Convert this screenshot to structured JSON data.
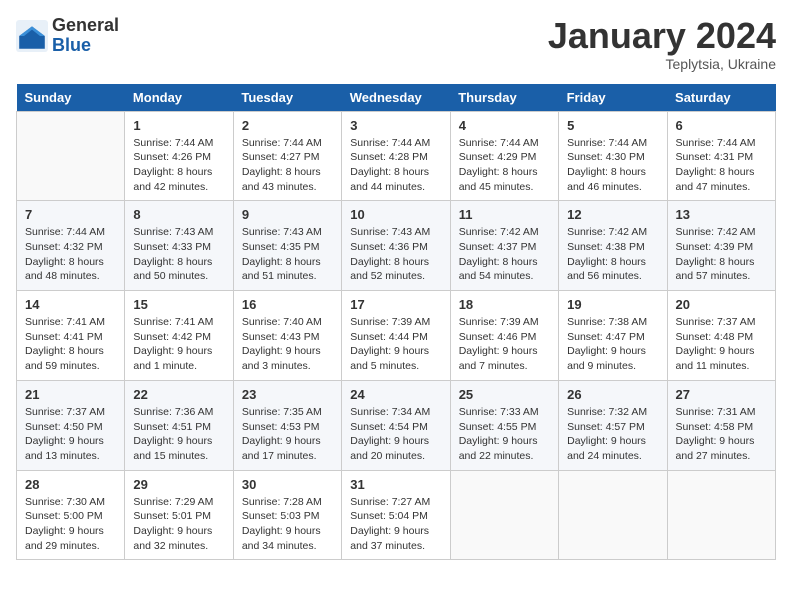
{
  "header": {
    "logo_general": "General",
    "logo_blue": "Blue",
    "month_title": "January 2024",
    "location": "Teplytsia, Ukraine"
  },
  "days_of_week": [
    "Sunday",
    "Monday",
    "Tuesday",
    "Wednesday",
    "Thursday",
    "Friday",
    "Saturday"
  ],
  "weeks": [
    [
      {
        "day": "",
        "sunrise": "",
        "sunset": "",
        "daylight": ""
      },
      {
        "day": "1",
        "sunrise": "Sunrise: 7:44 AM",
        "sunset": "Sunset: 4:26 PM",
        "daylight": "Daylight: 8 hours and 42 minutes."
      },
      {
        "day": "2",
        "sunrise": "Sunrise: 7:44 AM",
        "sunset": "Sunset: 4:27 PM",
        "daylight": "Daylight: 8 hours and 43 minutes."
      },
      {
        "day": "3",
        "sunrise": "Sunrise: 7:44 AM",
        "sunset": "Sunset: 4:28 PM",
        "daylight": "Daylight: 8 hours and 44 minutes."
      },
      {
        "day": "4",
        "sunrise": "Sunrise: 7:44 AM",
        "sunset": "Sunset: 4:29 PM",
        "daylight": "Daylight: 8 hours and 45 minutes."
      },
      {
        "day": "5",
        "sunrise": "Sunrise: 7:44 AM",
        "sunset": "Sunset: 4:30 PM",
        "daylight": "Daylight: 8 hours and 46 minutes."
      },
      {
        "day": "6",
        "sunrise": "Sunrise: 7:44 AM",
        "sunset": "Sunset: 4:31 PM",
        "daylight": "Daylight: 8 hours and 47 minutes."
      }
    ],
    [
      {
        "day": "7",
        "sunrise": "Sunrise: 7:44 AM",
        "sunset": "Sunset: 4:32 PM",
        "daylight": "Daylight: 8 hours and 48 minutes."
      },
      {
        "day": "8",
        "sunrise": "Sunrise: 7:43 AM",
        "sunset": "Sunset: 4:33 PM",
        "daylight": "Daylight: 8 hours and 50 minutes."
      },
      {
        "day": "9",
        "sunrise": "Sunrise: 7:43 AM",
        "sunset": "Sunset: 4:35 PM",
        "daylight": "Daylight: 8 hours and 51 minutes."
      },
      {
        "day": "10",
        "sunrise": "Sunrise: 7:43 AM",
        "sunset": "Sunset: 4:36 PM",
        "daylight": "Daylight: 8 hours and 52 minutes."
      },
      {
        "day": "11",
        "sunrise": "Sunrise: 7:42 AM",
        "sunset": "Sunset: 4:37 PM",
        "daylight": "Daylight: 8 hours and 54 minutes."
      },
      {
        "day": "12",
        "sunrise": "Sunrise: 7:42 AM",
        "sunset": "Sunset: 4:38 PM",
        "daylight": "Daylight: 8 hours and 56 minutes."
      },
      {
        "day": "13",
        "sunrise": "Sunrise: 7:42 AM",
        "sunset": "Sunset: 4:39 PM",
        "daylight": "Daylight: 8 hours and 57 minutes."
      }
    ],
    [
      {
        "day": "14",
        "sunrise": "Sunrise: 7:41 AM",
        "sunset": "Sunset: 4:41 PM",
        "daylight": "Daylight: 8 hours and 59 minutes."
      },
      {
        "day": "15",
        "sunrise": "Sunrise: 7:41 AM",
        "sunset": "Sunset: 4:42 PM",
        "daylight": "Daylight: 9 hours and 1 minute."
      },
      {
        "day": "16",
        "sunrise": "Sunrise: 7:40 AM",
        "sunset": "Sunset: 4:43 PM",
        "daylight": "Daylight: 9 hours and 3 minutes."
      },
      {
        "day": "17",
        "sunrise": "Sunrise: 7:39 AM",
        "sunset": "Sunset: 4:44 PM",
        "daylight": "Daylight: 9 hours and 5 minutes."
      },
      {
        "day": "18",
        "sunrise": "Sunrise: 7:39 AM",
        "sunset": "Sunset: 4:46 PM",
        "daylight": "Daylight: 9 hours and 7 minutes."
      },
      {
        "day": "19",
        "sunrise": "Sunrise: 7:38 AM",
        "sunset": "Sunset: 4:47 PM",
        "daylight": "Daylight: 9 hours and 9 minutes."
      },
      {
        "day": "20",
        "sunrise": "Sunrise: 7:37 AM",
        "sunset": "Sunset: 4:48 PM",
        "daylight": "Daylight: 9 hours and 11 minutes."
      }
    ],
    [
      {
        "day": "21",
        "sunrise": "Sunrise: 7:37 AM",
        "sunset": "Sunset: 4:50 PM",
        "daylight": "Daylight: 9 hours and 13 minutes."
      },
      {
        "day": "22",
        "sunrise": "Sunrise: 7:36 AM",
        "sunset": "Sunset: 4:51 PM",
        "daylight": "Daylight: 9 hours and 15 minutes."
      },
      {
        "day": "23",
        "sunrise": "Sunrise: 7:35 AM",
        "sunset": "Sunset: 4:53 PM",
        "daylight": "Daylight: 9 hours and 17 minutes."
      },
      {
        "day": "24",
        "sunrise": "Sunrise: 7:34 AM",
        "sunset": "Sunset: 4:54 PM",
        "daylight": "Daylight: 9 hours and 20 minutes."
      },
      {
        "day": "25",
        "sunrise": "Sunrise: 7:33 AM",
        "sunset": "Sunset: 4:55 PM",
        "daylight": "Daylight: 9 hours and 22 minutes."
      },
      {
        "day": "26",
        "sunrise": "Sunrise: 7:32 AM",
        "sunset": "Sunset: 4:57 PM",
        "daylight": "Daylight: 9 hours and 24 minutes."
      },
      {
        "day": "27",
        "sunrise": "Sunrise: 7:31 AM",
        "sunset": "Sunset: 4:58 PM",
        "daylight": "Daylight: 9 hours and 27 minutes."
      }
    ],
    [
      {
        "day": "28",
        "sunrise": "Sunrise: 7:30 AM",
        "sunset": "Sunset: 5:00 PM",
        "daylight": "Daylight: 9 hours and 29 minutes."
      },
      {
        "day": "29",
        "sunrise": "Sunrise: 7:29 AM",
        "sunset": "Sunset: 5:01 PM",
        "daylight": "Daylight: 9 hours and 32 minutes."
      },
      {
        "day": "30",
        "sunrise": "Sunrise: 7:28 AM",
        "sunset": "Sunset: 5:03 PM",
        "daylight": "Daylight: 9 hours and 34 minutes."
      },
      {
        "day": "31",
        "sunrise": "Sunrise: 7:27 AM",
        "sunset": "Sunset: 5:04 PM",
        "daylight": "Daylight: 9 hours and 37 minutes."
      },
      {
        "day": "",
        "sunrise": "",
        "sunset": "",
        "daylight": ""
      },
      {
        "day": "",
        "sunrise": "",
        "sunset": "",
        "daylight": ""
      },
      {
        "day": "",
        "sunrise": "",
        "sunset": "",
        "daylight": ""
      }
    ]
  ]
}
